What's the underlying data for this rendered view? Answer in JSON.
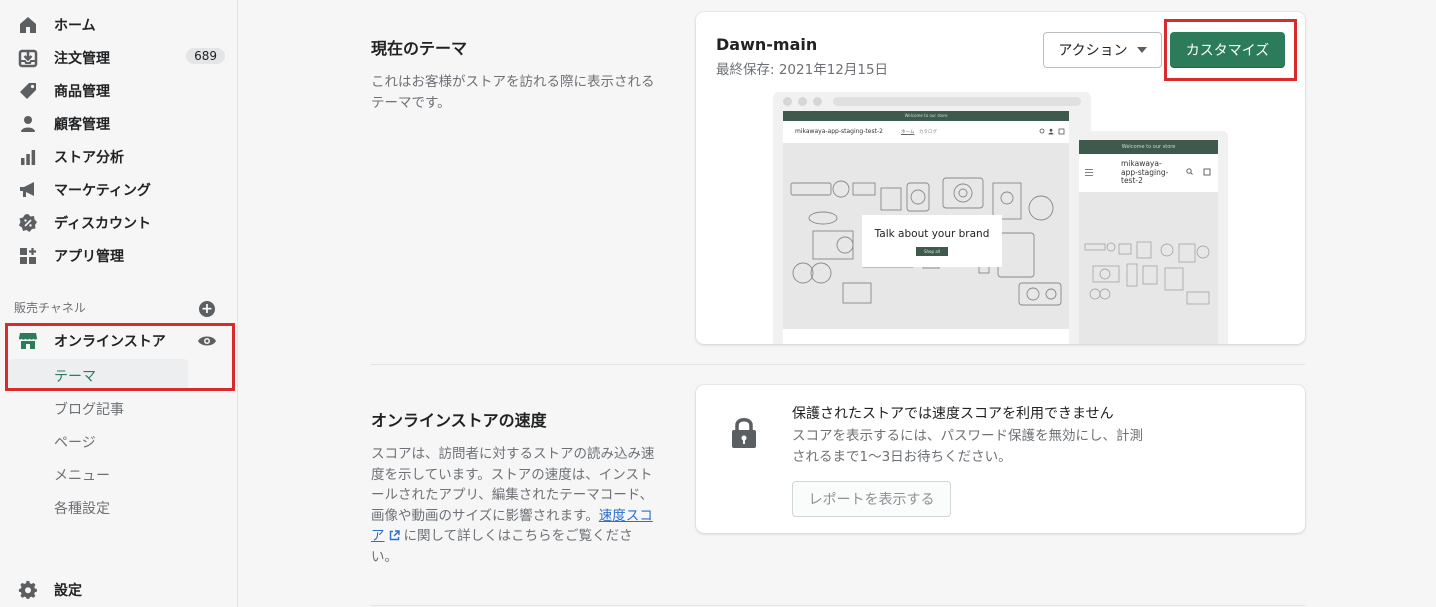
{
  "sidebar": {
    "items": [
      {
        "label": "ホーム",
        "icon": "home-icon"
      },
      {
        "label": "注文管理",
        "icon": "orders-icon",
        "badge": "689"
      },
      {
        "label": "商品管理",
        "icon": "tag-icon"
      },
      {
        "label": "顧客管理",
        "icon": "person-icon"
      },
      {
        "label": "ストア分析",
        "icon": "bar-chart-icon"
      },
      {
        "label": "マーケティング",
        "icon": "megaphone-icon"
      },
      {
        "label": "ディスカウント",
        "icon": "discount-icon"
      },
      {
        "label": "アプリ管理",
        "icon": "apps-icon"
      }
    ],
    "sales_channels_label": "販売チャネル",
    "online_store": {
      "label": "オンラインストア",
      "sub_items": [
        "テーマ",
        "ブログ記事",
        "ページ",
        "メニュー",
        "各種設定"
      ]
    },
    "settings_label": "設定"
  },
  "current_theme": {
    "heading": "現在のテーマ",
    "description": "これはお客様がストアを訪れる際に表示されるテーマです。",
    "name": "Dawn-main",
    "last_saved": "最終保存: 2021年12月15日",
    "actions_label": "アクション",
    "customize_label": "カスタマイズ"
  },
  "preview": {
    "banner_text": "Welcome to our store",
    "store_name": "mikawaya-app-staging-test-2",
    "mobile_store_name": "mikawaya-\napp-staging-\ntest-2",
    "nav_home": "ホーム",
    "nav_catalog": "カタログ",
    "hero_text": "Talk about your brand",
    "hero_button": "Shop all"
  },
  "speed": {
    "heading": "オンラインストアの速度",
    "description_part1": "スコアは、訪問者に対するストアの読み込み速度を示しています。ストアの速度は、インストールされたアプリ、編集されたテーマコード、画像や動画のサイズに影響されます。",
    "link_text": "速度スコア",
    "description_part2": "に関して詳しくはこちらをご覧ください。",
    "card_title": "保護されたストアでは速度スコアを利用できません",
    "card_text": "スコアを表示するには、パスワード保護を無効にし、計測されるまで1〜3日お待ちください。",
    "report_button": "レポートを表示する"
  },
  "colors": {
    "primary": "#2c7c5c",
    "highlight": "#d82c2c",
    "active_text": "#2c7c5c"
  }
}
